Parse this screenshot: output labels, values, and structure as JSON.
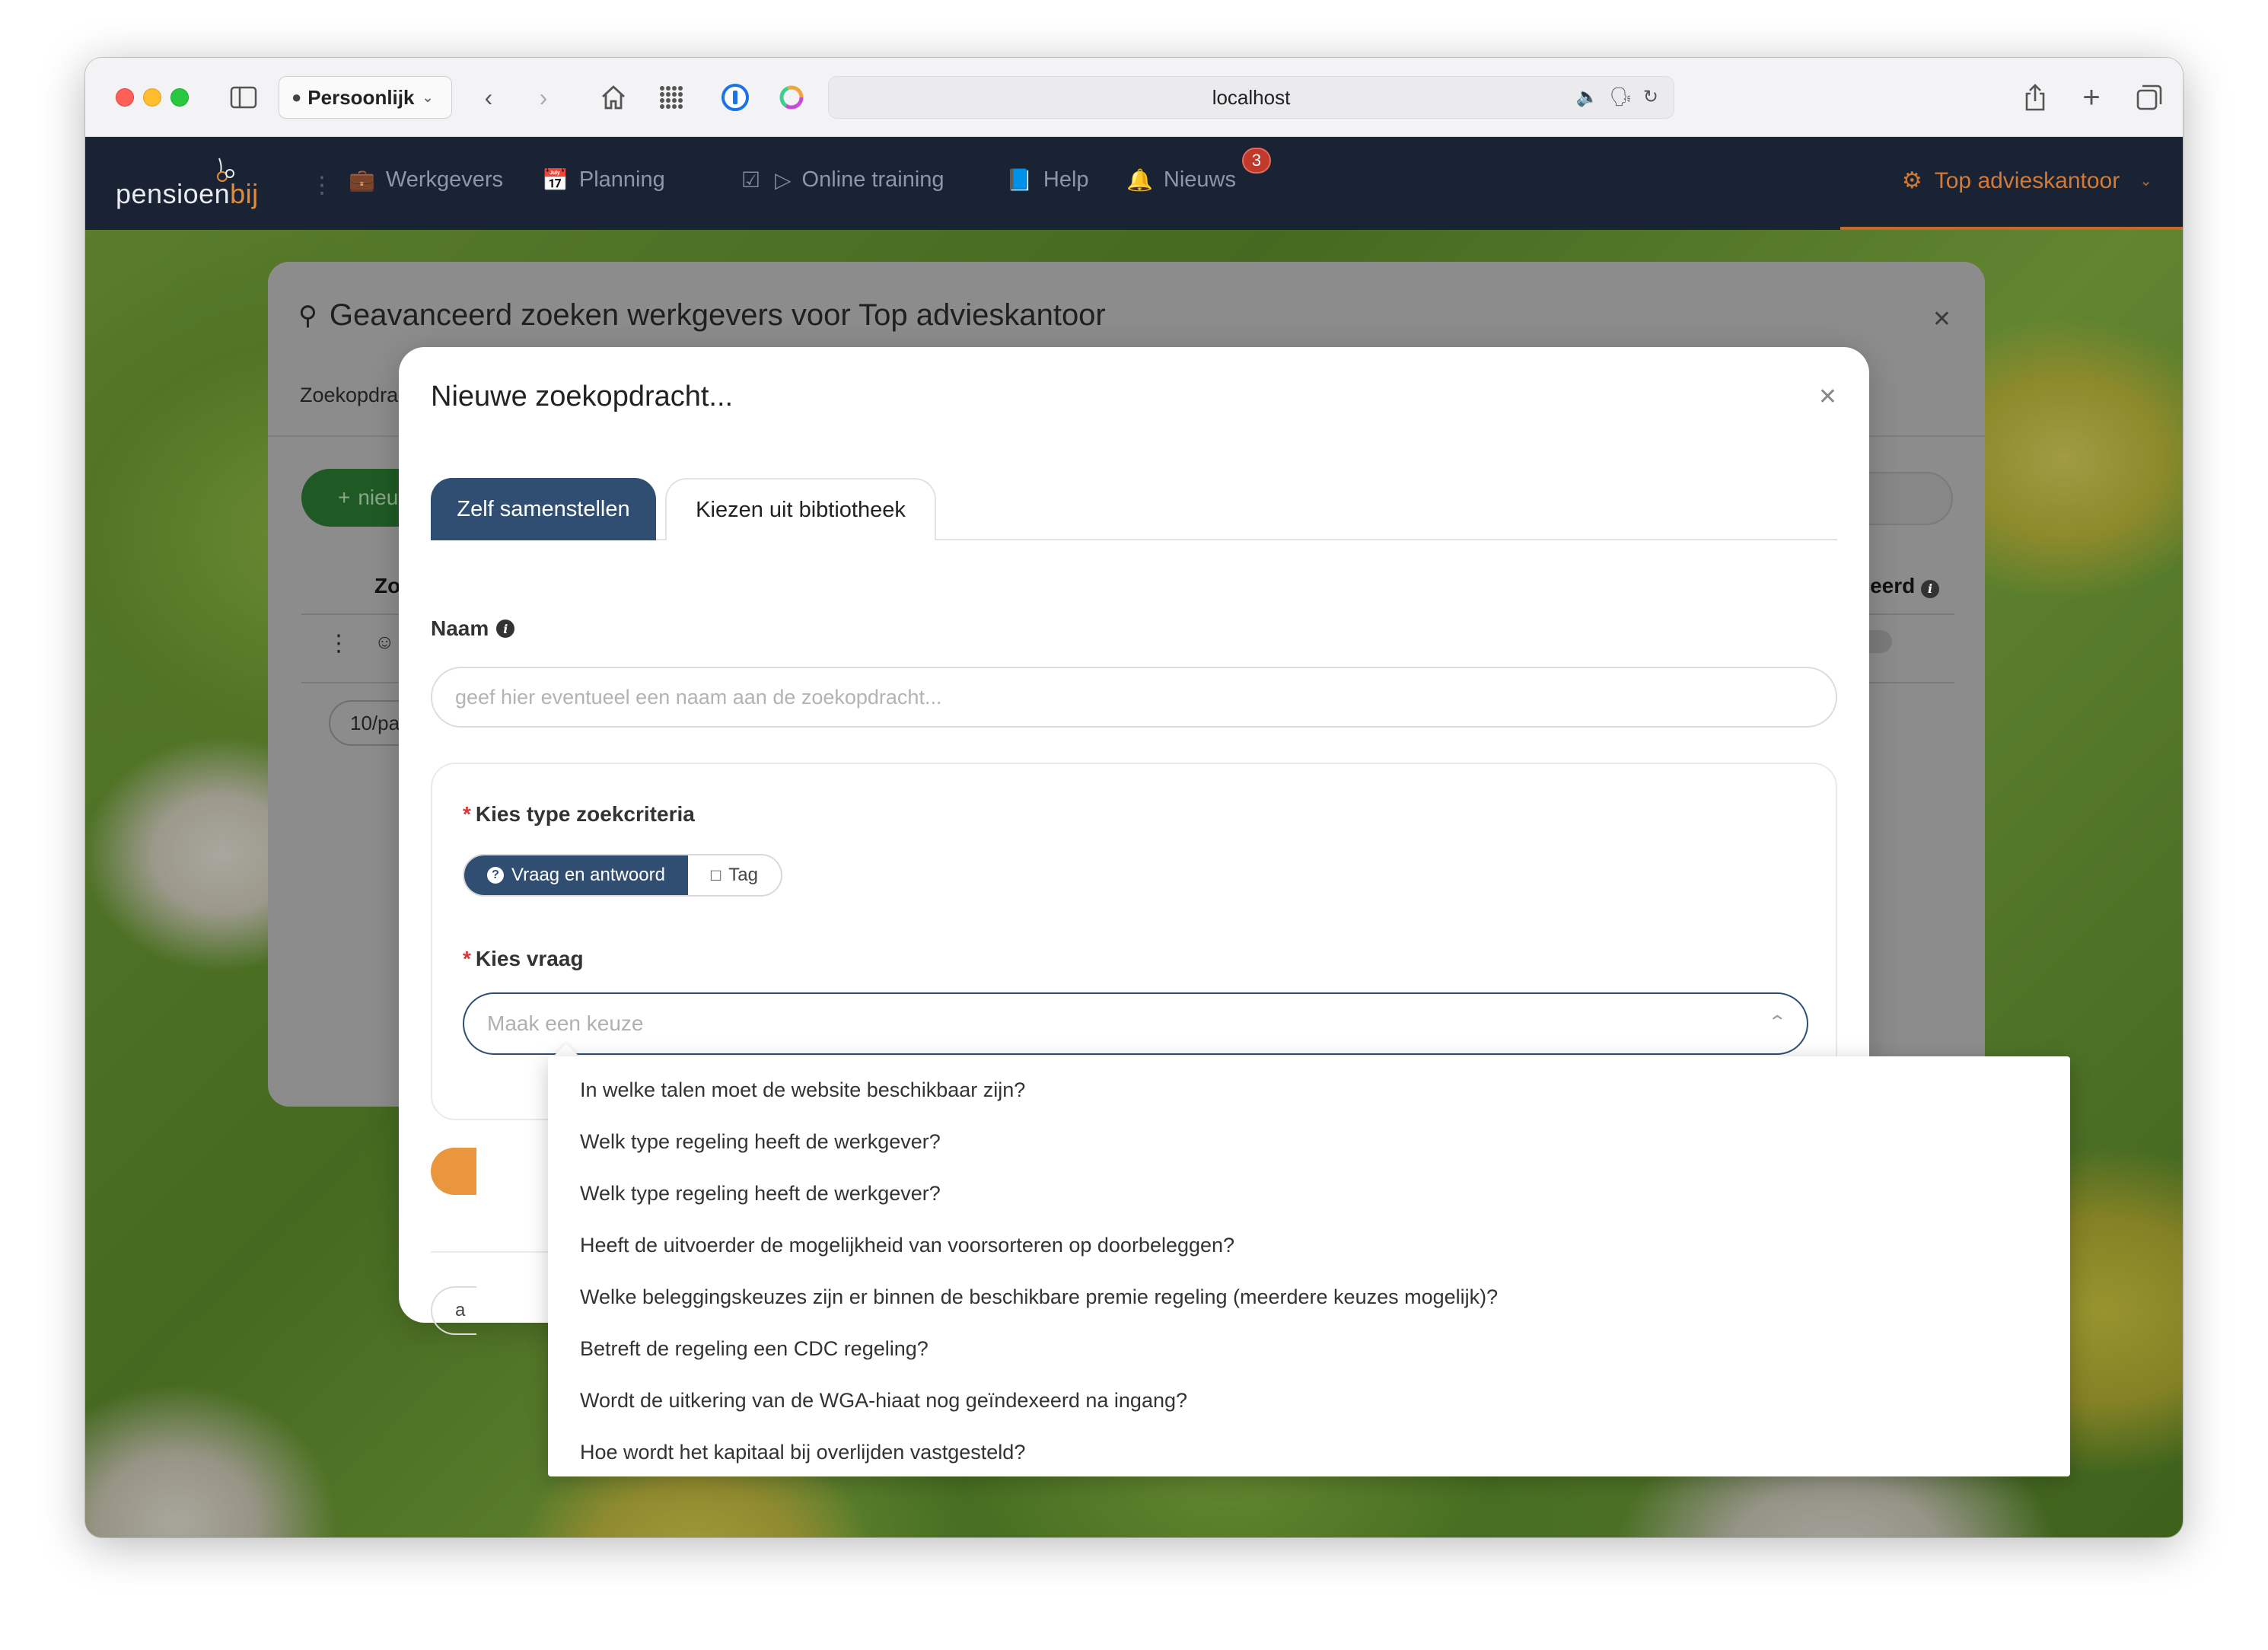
{
  "browser": {
    "profile_label": "Persoonlijk",
    "url": "localhost"
  },
  "nav": {
    "logo_main": "pensioen",
    "logo_accent": "bij",
    "items": [
      {
        "label": "Werkgevers",
        "icon": "briefcase-icon"
      },
      {
        "label": "Planning",
        "icon": "calendar-icon"
      },
      {
        "label": "",
        "icon": "clipboard-check-icon"
      },
      {
        "label": "Online training",
        "icon": "play-circle-icon"
      },
      {
        "label": "Help",
        "icon": "book-icon"
      },
      {
        "label": "Nieuws",
        "icon": "bell-icon"
      }
    ],
    "news_badge": "3",
    "account_label": "Top advieskantoor"
  },
  "back_modal": {
    "title": "Geavanceerd zoeken werkgevers voor Top advieskantoor",
    "tab_partial": "Zoekopdra",
    "new_button_partial": "nieu",
    "column_partial": "Zo",
    "column_right_partial": "iceerd",
    "pager_partial": "10/pa"
  },
  "modal": {
    "title": "Nieuwe zoekopdracht...",
    "tabs": [
      {
        "label": "Zelf samenstellen",
        "active": true
      },
      {
        "label": "Kiezen uit bibtiotheek",
        "active": false
      }
    ],
    "name_label": "Naam",
    "name_placeholder": "geef hier eventueel een naam aan de zoekopdracht...",
    "criteria_label": "Kies type zoekcriteria",
    "criteria_options": [
      {
        "label": "Vraag en antwoord",
        "active": true
      },
      {
        "label": "Tag",
        "active": false
      }
    ],
    "question_label": "Kies vraag",
    "question_placeholder": "Maak een keuze",
    "bottom_partial": "a"
  },
  "dropdown": {
    "options": [
      "In welke talen moet de website beschikbaar zijn?",
      "Welk type regeling heeft de werkgever?",
      "Welk type regeling heeft de werkgever?",
      "Heeft de uitvoerder de mogelijkheid van voorsorteren op doorbeleggen?",
      "Welke beleggingskeuzes zijn er binnen de beschikbare premie regeling (meerdere keuzes mogelijk)?",
      "Betreft de regeling een CDC regeling?",
      "Wordt de uitkering van de WGA-hiaat nog geïndexeerd na ingang?",
      "Hoe wordt het kapitaal bij overlijden vastgesteld?"
    ]
  },
  "colors": {
    "nav_bg": "#1a2333",
    "primary": "#2f4e72",
    "accent_orange": "#e08a3a",
    "required": "#d9363e",
    "badge": "#c0392b"
  }
}
